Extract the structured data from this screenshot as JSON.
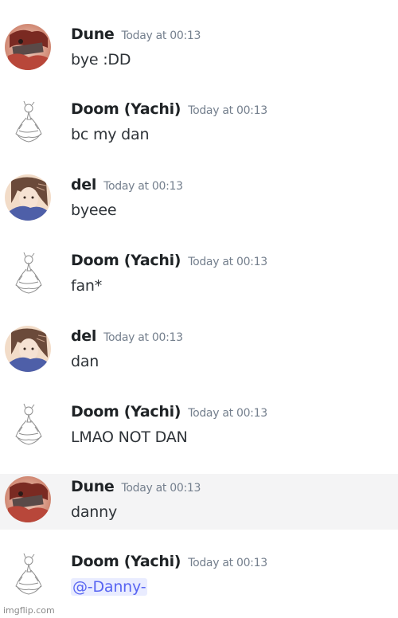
{
  "messages": [
    {
      "author": "Dune",
      "timestamp": "Today at 00:13",
      "text": "bye :DD",
      "avatar": "dune-avatar",
      "highlighted": false
    },
    {
      "author": "Doom (Yachi)",
      "timestamp": "Today at 00:13",
      "text": "bc my dan",
      "avatar": "doom-avatar",
      "highlighted": false
    },
    {
      "author": "del",
      "timestamp": "Today at 00:13",
      "text": "byeee",
      "avatar": "del-avatar",
      "highlighted": false
    },
    {
      "author": "Doom (Yachi)",
      "timestamp": "Today at 00:13",
      "text": "fan*",
      "avatar": "doom-avatar",
      "highlighted": false
    },
    {
      "author": "del",
      "timestamp": "Today at 00:13",
      "text": "dan",
      "avatar": "del-avatar",
      "highlighted": false
    },
    {
      "author": "Doom (Yachi)",
      "timestamp": "Today at 00:13",
      "text": "LMAO NOT DAN",
      "avatar": "doom-avatar",
      "highlighted": false
    },
    {
      "author": "Dune",
      "timestamp": "Today at 00:13",
      "text": "danny",
      "avatar": "dune-avatar",
      "highlighted": true
    },
    {
      "author": "Doom (Yachi)",
      "timestamp": "Today at 00:13",
      "mention": "@-Danny-",
      "avatar": "doom-avatar",
      "highlighted": false
    }
  ],
  "watermark": "imgflip.com",
  "colors": {
    "mention_bg": "#e9ecff",
    "mention_text": "#5865f2",
    "timestamp": "#747f8d",
    "hover_row": "#f4f4f5"
  }
}
